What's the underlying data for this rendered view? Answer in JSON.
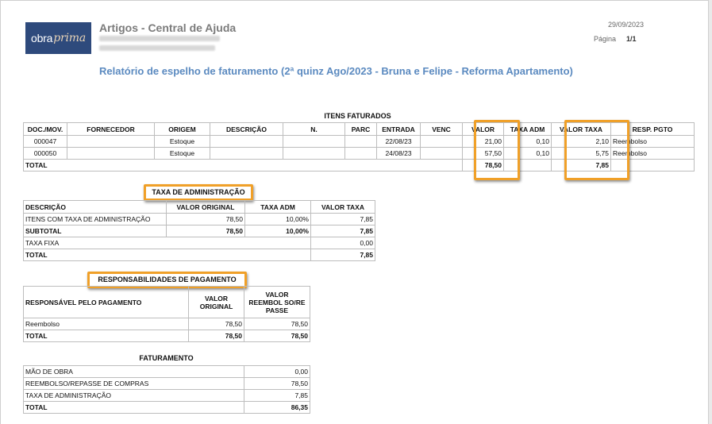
{
  "header": {
    "logo_part1": "obra",
    "logo_part2": "prima",
    "title": "Artigos - Central de Ajuda",
    "date": "29/09/2023",
    "page_label": "Página",
    "page_value": "1/1",
    "report_title": "Relatório de espelho de faturamento (2ª quinz Ago/2023 - Bruna e Felipe - Reforma Apartamento)"
  },
  "itens": {
    "title": "ITENS FATURADOS",
    "columns": [
      "DOC./MOV.",
      "FORNECEDOR",
      "ORIGEM",
      "DESCRIÇÃO",
      "N.",
      "PARC",
      "ENTRADA",
      "VENC",
      "VALOR",
      "TAXA ADM",
      "VALOR TAXA",
      "RESP. PGTO"
    ],
    "rows": [
      [
        "000047",
        "",
        "Estoque",
        "",
        "",
        "",
        "22/08/23",
        "",
        "21,00",
        "0,10",
        "2,10",
        "Reembolso"
      ],
      [
        "000050",
        "",
        "Estoque",
        "",
        "",
        "",
        "24/08/23",
        "",
        "57,50",
        "0,10",
        "5,75",
        "Reembolso"
      ]
    ],
    "total_label": "TOTAL",
    "total_valor": "78,50",
    "total_taxa": "7,85"
  },
  "taxa": {
    "title": "TAXA DE ADMINISTRAÇÃO",
    "columns": [
      "DESCRIÇÃO",
      "VALOR ORIGINAL",
      "TAXA ADM",
      "VALOR TAXA"
    ],
    "rows": [
      [
        "ITENS COM TAXA DE ADMINISTRAÇÃO",
        "78,50",
        "10,00%",
        "7,85"
      ],
      [
        "SUBTOTAL",
        "78,50",
        "10,00%",
        "7,85"
      ]
    ],
    "fixa_label": "TAXA FIXA",
    "fixa_value": "0,00",
    "total_label": "TOTAL",
    "total_value": "7,85"
  },
  "resp": {
    "title": "RESPONSABILIDADES DE PAGAMENTO",
    "col1": "RESPONSÁVEL PELO PAGAMENTO",
    "col2_l1": "VALOR",
    "col2_l2": "ORIGINAL",
    "col3_l1": "VALOR",
    "col3_l2": "REEMBOL SO/RE",
    "col3_l3": "PASSE",
    "rows": [
      [
        "Reembolso",
        "78,50",
        "78,50"
      ],
      [
        "TOTAL",
        "78,50",
        "78,50"
      ]
    ]
  },
  "fat": {
    "title": "FATURAMENTO",
    "rows": [
      [
        "MÃO DE OBRA",
        "0,00"
      ],
      [
        "REEMBOLSO/REPASSE DE COMPRAS",
        "78,50"
      ],
      [
        "TAXA DE ADMINISTRAÇÃO",
        "7,85"
      ],
      [
        "TOTAL",
        "86,35"
      ]
    ]
  },
  "colors": {
    "accent": "#f0a028",
    "title_blue": "#5b8ac0",
    "logo_bg": "#2e4a7c"
  }
}
